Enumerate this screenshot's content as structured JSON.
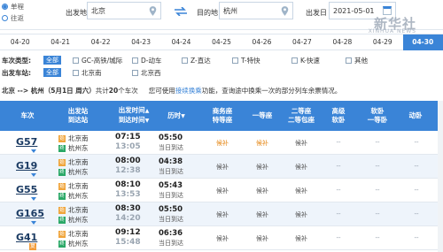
{
  "query": {
    "trip_options": [
      {
        "label": "单程",
        "selected": true
      },
      {
        "label": "往返",
        "selected": false
      }
    ],
    "from_label": "出发地",
    "from_value": "北京",
    "to_label": "目的地",
    "to_value": "杭州",
    "date_label": "出发日",
    "date_value": "2021-05-01"
  },
  "watermark": {
    "main": "新华社",
    "sub": "XINHUA NEWS"
  },
  "dates": [
    "04-20",
    "04-21",
    "04-22",
    "04-23",
    "04-24",
    "04-25",
    "04-26",
    "04-27",
    "04-28",
    "04-29",
    "04-30"
  ],
  "active_date_index": 10,
  "filters": {
    "type_title": "车次类型:",
    "all_label": "全部",
    "types": [
      "GC-高铁/城际",
      "D-动车",
      "Z-直达",
      "T-特快",
      "K-快速",
      "其他"
    ],
    "station_title": "出发车站:",
    "stations": [
      "北京南",
      "北京西"
    ]
  },
  "summary": {
    "route": "北京 --> 杭州",
    "date": "（5月1日 周六）",
    "count_prefix": "共计",
    "count": "20",
    "count_suffix": "个车次",
    "hint_prefix": "您可使用",
    "hint_link": "接续换乘",
    "hint_suffix": "功能，查询途中换乘一次的部分列车余票情况。"
  },
  "headers": {
    "train": "车次",
    "station_1": "出发站",
    "station_2": "到达站",
    "time_1": "出发时间",
    "time_2": "到达时间",
    "duration": "历时",
    "business_1": "商务座",
    "business_2": "特等座",
    "first": "一等座",
    "second_1": "二等座",
    "second_2": "二等包座",
    "adv_1": "高级",
    "adv_2": "软卧",
    "soft_1": "软卧",
    "soft_2": "一等卧",
    "dongwo": "动卧"
  },
  "rows": [
    {
      "code": "G57",
      "fu": "",
      "from": "北京南",
      "to": "杭州东",
      "dep": "07:15",
      "arr": "13:05",
      "dur": "05:50",
      "day": "当日到达",
      "business": "候补",
      "first": "候补",
      "second": "候补",
      "adv": "--",
      "soft": "--",
      "dongwo": "--"
    },
    {
      "code": "G19",
      "fu": "",
      "from": "北京南",
      "to": "杭州东",
      "dep": "08:00",
      "arr": "12:38",
      "dur": "04:38",
      "day": "当日到达",
      "business": "候补",
      "first": "候补",
      "second": "候补",
      "adv": "--",
      "soft": "--",
      "dongwo": "--"
    },
    {
      "code": "G55",
      "fu": "",
      "from": "北京南",
      "to": "杭州东",
      "dep": "08:10",
      "arr": "13:53",
      "dur": "05:43",
      "day": "当日到达",
      "business": "候补",
      "first": "候补",
      "second": "候补",
      "adv": "--",
      "soft": "--",
      "dongwo": "--"
    },
    {
      "code": "G165",
      "fu": "",
      "from": "北京南",
      "to": "杭州东",
      "dep": "08:30",
      "arr": "14:20",
      "dur": "05:50",
      "day": "当日到达",
      "business": "候补",
      "first": "候补",
      "second": "候补",
      "adv": "--",
      "soft": "--",
      "dongwo": "--"
    },
    {
      "code": "G41",
      "fu": "复",
      "from": "北京南",
      "to": "杭州东",
      "dep": "09:12",
      "arr": "15:48",
      "dur": "06:36",
      "day": "当日到达",
      "business": "候补",
      "first": "候补",
      "second": "候补",
      "adv": "--",
      "soft": "--",
      "dongwo": "--"
    }
  ],
  "colors": {
    "accent": "#3a84d7",
    "waitlist": "#e68a1b"
  }
}
